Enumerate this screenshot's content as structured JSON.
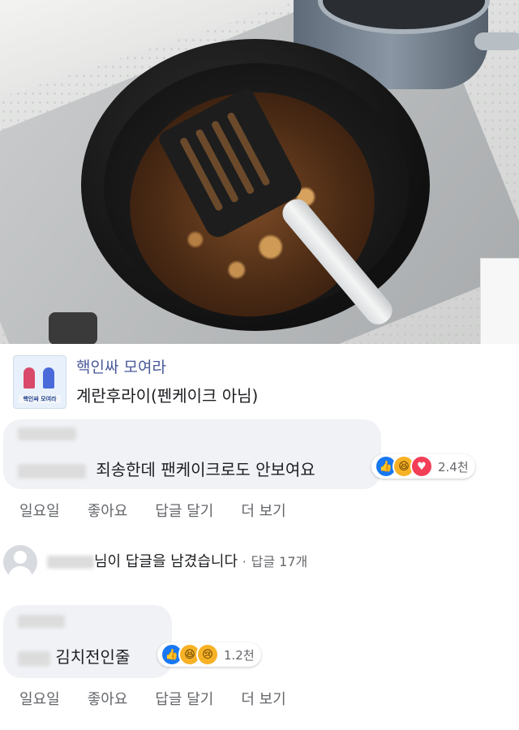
{
  "post": {
    "page_name": "핵인싸 모여라",
    "post_text": "계란후라이(펜케이크 아님)",
    "avatar_banner": "핵인싸 모여라"
  },
  "comments": [
    {
      "text": "죄송한데 팬케이크로도 안보여요",
      "reactions": [
        "like-icon",
        "haha-icon",
        "love-icon"
      ],
      "reaction_count": "2.4천",
      "actions": {
        "time": "일요일",
        "like": "좋아요",
        "reply": "답글 달기",
        "more": "더 보기"
      }
    },
    {
      "text": "김치전인줄",
      "reactions": [
        "like-icon",
        "haha-icon",
        "sad-icon"
      ],
      "reaction_count": "1.2천",
      "actions": {
        "time": "일요일",
        "like": "좋아요",
        "reply": "답글 달기",
        "more": "더 보기"
      }
    }
  ],
  "reply_notice": {
    "text": "님이 답글을 남겼습니다",
    "separator": "·",
    "count_label": "답글 17개"
  },
  "colors": {
    "like": "#1877f2",
    "love": "#f33e58",
    "haha": "#f7b125",
    "bubble": "#f0f2f5",
    "meta_text": "#65676b"
  }
}
